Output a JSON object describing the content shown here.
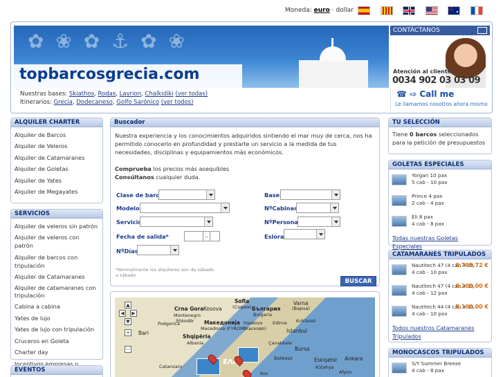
{
  "topbar": {
    "moneda_label": "Moneda:",
    "currency_active": "euro",
    "currency_sep": "·",
    "currency_other": "dollar",
    "languages": [
      "es",
      "ca",
      "en-gb",
      "en-us",
      "en-au",
      "fr"
    ]
  },
  "header": {
    "site_title": "topbarcosgrecia.com",
    "contact_label": "CONTÁCTANOS",
    "attention_label": "Atención al cliente",
    "phone": "0034 902 03 03 09",
    "callme_label": "☎ ⇨ Call me",
    "callme_sub": "Le llamamos nosotros ahora mismo",
    "bases_label": "Nuestras bases:",
    "bases": [
      "Skiathos",
      "Rodas",
      "Lavrion",
      "Chalkidiki"
    ],
    "bases_all": "(ver todas)",
    "itin_label": "Itinerarios:",
    "itineraries": [
      "Grecia",
      "Dodecaneso",
      "Golfo Sarónico"
    ],
    "itin_all": "(ver todos)"
  },
  "left": {
    "charter_title": "ALQUILER CHARTER",
    "charter_items": [
      "Alquiler de Barcos",
      "Alquiler de Veleros",
      "Alquiler de Catamaranes",
      "Alquiler de Goletas",
      "Alquiler de Yates",
      "Alquiler de Megayates"
    ],
    "services_title": "SERVICIOS",
    "services_items": [
      "Alquiler de veleros sin patrón",
      "Alquiler de veleros con patrón",
      "Alquiler de barcos con tripulación",
      "Alquiler de Catamaranes",
      "Alquiler de catamaranes con tripulación",
      "Cabina a cabina",
      "Yates de lujo",
      "Yates de lujo con tripulación",
      "Cruceros en Goleta",
      "Charter day",
      "Incentivos empresas o grupos"
    ],
    "events_title": "EVENTOS"
  },
  "search": {
    "title": "Buscador",
    "intro": "Nuestra experiencia y los conocimientos adquiridos sintiendo el mar muy de cerca, nos ha permitido conocerlo en profundidad y prestarte un servicio a la medida de tus necesidades, disciplinas y equipamientos más económicos.",
    "compare_bold": "Comprueba",
    "compare_rest": " los precios más asequibles",
    "consult_bold": "Consúltanos",
    "consult_rest": " cualquier duda.",
    "labels": {
      "clase": "Clase de barco",
      "modelo": "Modelo",
      "servicio": "Servicio",
      "fecha": "Fecha de salida*",
      "dias": "NºDías",
      "base": "Base",
      "cabinas": "NºCabinas",
      "personas": "NºPersonas",
      "eslora": "Eslora"
    },
    "date_btn": "..",
    "note_line1": "*Normalmente los alquileres son de sábado",
    "note_line2": "a sábado",
    "submit": "BUSCAR"
  },
  "map": {
    "labels": [
      "Crna Gora",
      "Kosova",
      "Sofia",
      "(София)",
      "Varna",
      "(Варна)",
      "Montenegro",
      "България",
      "Bulgaria",
      "Shkodër",
      "Македонија",
      "Podgorica",
      "Macedonia (FYROM)",
      "Haskovo",
      "(Хасково)",
      "Edirne",
      "Kırklareli",
      "Bari",
      "Shqipëria",
      "Albania",
      "Istanbul",
      "Çanakkale",
      "Bursa",
      "Balıkesir",
      "Eskişehir",
      "Ankara",
      "Catanzaro",
      "Kütahya",
      "Afyon",
      "ΕΛΛ",
      "Kos"
    ]
  },
  "right": {
    "selection_title": "TU SELECCIÓN",
    "selection_pre": "Tiene ",
    "selection_count": "0 barcos",
    "selection_post": " seleccionados para la petición de presupuestos",
    "goletas_title": "GOLETAS ESPECIALES",
    "goletas": [
      {
        "name": "Yorgan 10 pax",
        "detail": "5 cab - 10 pax"
      },
      {
        "name": "Prince 4 pax",
        "detail": "2 cab - 4 pax"
      },
      {
        "name": "Eli 8 pax",
        "detail": "4 cab - 8 pax"
      }
    ],
    "goletas_link": "Todas nuestras Goletas Especiales",
    "cats_title": "CATAMARANES TRIPULADOS",
    "cats": [
      {
        "name": "Nautitech 47 (4 cab + 2)",
        "detail": "4 cab - 10 pax",
        "price": "8.799,72 €"
      },
      {
        "name": "Nautitech 47 (4 cab + 2)",
        "detail": "4 cab - 12 pax",
        "price": "6.200,00 €"
      },
      {
        "name": "Nautitech 44 (4 cab + 2)",
        "detail": "4 cab - 10 pax",
        "price": "5.100,00 €"
      }
    ],
    "cats_link": "Todos nuestros Catamaranes Tripulados",
    "mono_title": "MONOCASCOS TRIPULADOS",
    "mono": [
      {
        "name": "S/Y Summer Breeze",
        "detail": "4 cab - 8 pax"
      }
    ]
  }
}
